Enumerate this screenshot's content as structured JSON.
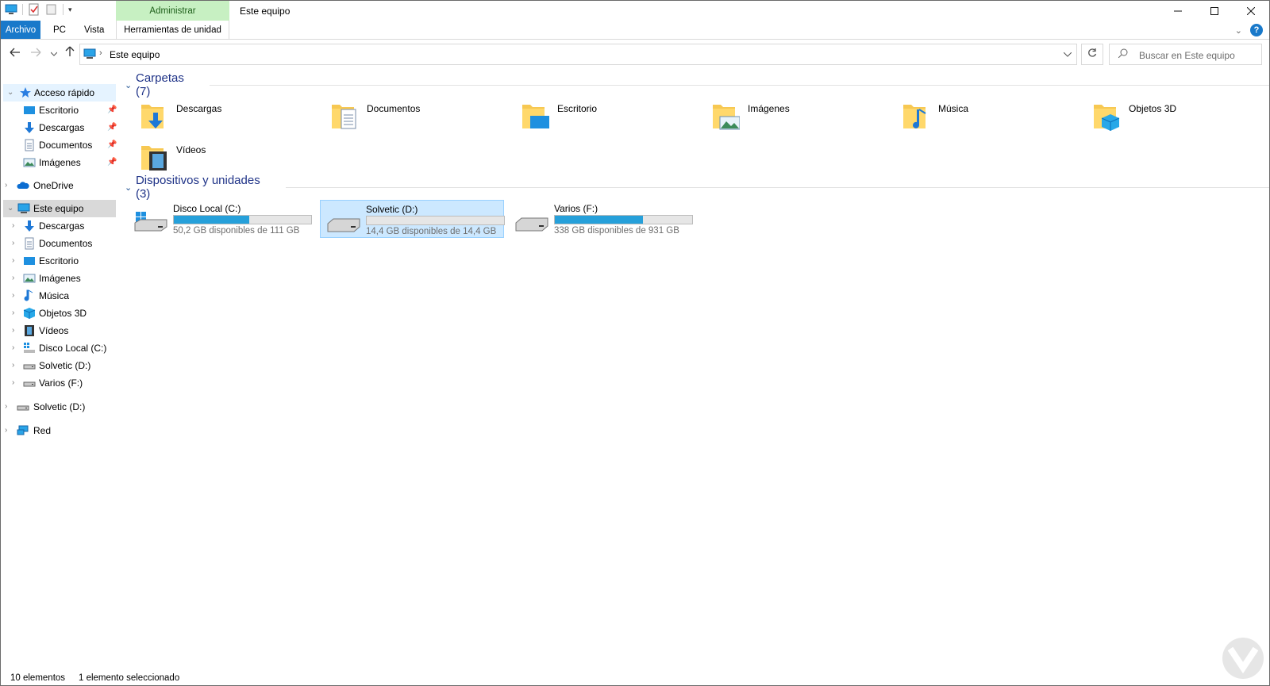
{
  "window": {
    "title": "Este equipo",
    "context_tab_header": "Administrar"
  },
  "ribbon": {
    "tabs": [
      "Archivo",
      "PC",
      "Vista",
      "Herramientas de unidad"
    ],
    "help": "?"
  },
  "address": {
    "crumb": "Este equipo",
    "search_placeholder": "Buscar en Este equipo"
  },
  "sidebar": {
    "quick_access": "Acceso rápido",
    "quick_items": [
      "Escritorio",
      "Descargas",
      "Documentos",
      "Imágenes"
    ],
    "onedrive": "OneDrive",
    "this_pc": "Este equipo",
    "pc_items": [
      "Descargas",
      "Documentos",
      "Escritorio",
      "Imágenes",
      "Música",
      "Objetos 3D",
      "Vídeos",
      "Disco Local (C:)",
      "Solvetic (D:)",
      "Varios (F:)"
    ],
    "drive_d": "Solvetic (D:)",
    "network": "Red"
  },
  "content": {
    "folders_header": "Carpetas (7)",
    "folders": [
      "Descargas",
      "Documentos",
      "Escritorio",
      "Imágenes",
      "Música",
      "Objetos 3D",
      "Vídeos"
    ],
    "devices_header": "Dispositivos y unidades (3)",
    "drives": [
      {
        "name": "Disco Local (C:)",
        "free": "50,2 GB disponibles de 111 GB",
        "used_fraction": 0.55,
        "selected": false
      },
      {
        "name": "Solvetic (D:)",
        "free": "14,4 GB disponibles de 14,4 GB",
        "used_fraction": 0.0,
        "selected": true
      },
      {
        "name": "Varios (F:)",
        "free": "338 GB disponibles de 931 GB",
        "used_fraction": 0.64,
        "selected": false
      }
    ]
  },
  "status": {
    "count": "10 elementos",
    "selection": "1 elemento seleccionado"
  },
  "colors": {
    "accent": "#1979ca",
    "context_tab": "#c7f0c2",
    "group_header": "#1e3287",
    "bar_fill": "#26a0da",
    "selected": "#cce8ff"
  }
}
